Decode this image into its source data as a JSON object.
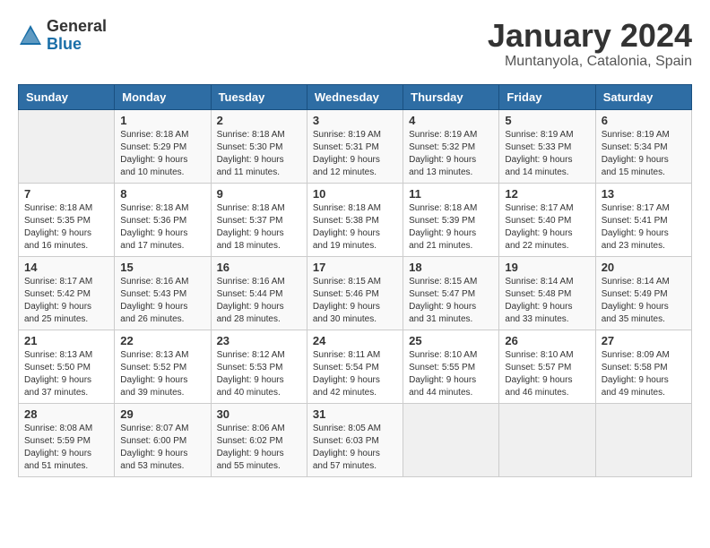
{
  "header": {
    "logo_general": "General",
    "logo_blue": "Blue",
    "title": "January 2024",
    "subtitle": "Muntanyola, Catalonia, Spain"
  },
  "days_of_week": [
    "Sunday",
    "Monday",
    "Tuesday",
    "Wednesday",
    "Thursday",
    "Friday",
    "Saturday"
  ],
  "weeks": [
    [
      {
        "day": "",
        "sunrise": "",
        "sunset": "",
        "daylight": ""
      },
      {
        "day": "1",
        "sunrise": "Sunrise: 8:18 AM",
        "sunset": "Sunset: 5:29 PM",
        "daylight": "Daylight: 9 hours and 10 minutes."
      },
      {
        "day": "2",
        "sunrise": "Sunrise: 8:18 AM",
        "sunset": "Sunset: 5:30 PM",
        "daylight": "Daylight: 9 hours and 11 minutes."
      },
      {
        "day": "3",
        "sunrise": "Sunrise: 8:19 AM",
        "sunset": "Sunset: 5:31 PM",
        "daylight": "Daylight: 9 hours and 12 minutes."
      },
      {
        "day": "4",
        "sunrise": "Sunrise: 8:19 AM",
        "sunset": "Sunset: 5:32 PM",
        "daylight": "Daylight: 9 hours and 13 minutes."
      },
      {
        "day": "5",
        "sunrise": "Sunrise: 8:19 AM",
        "sunset": "Sunset: 5:33 PM",
        "daylight": "Daylight: 9 hours and 14 minutes."
      },
      {
        "day": "6",
        "sunrise": "Sunrise: 8:19 AM",
        "sunset": "Sunset: 5:34 PM",
        "daylight": "Daylight: 9 hours and 15 minutes."
      }
    ],
    [
      {
        "day": "7",
        "sunrise": "Sunrise: 8:18 AM",
        "sunset": "Sunset: 5:35 PM",
        "daylight": "Daylight: 9 hours and 16 minutes."
      },
      {
        "day": "8",
        "sunrise": "Sunrise: 8:18 AM",
        "sunset": "Sunset: 5:36 PM",
        "daylight": "Daylight: 9 hours and 17 minutes."
      },
      {
        "day": "9",
        "sunrise": "Sunrise: 8:18 AM",
        "sunset": "Sunset: 5:37 PM",
        "daylight": "Daylight: 9 hours and 18 minutes."
      },
      {
        "day": "10",
        "sunrise": "Sunrise: 8:18 AM",
        "sunset": "Sunset: 5:38 PM",
        "daylight": "Daylight: 9 hours and 19 minutes."
      },
      {
        "day": "11",
        "sunrise": "Sunrise: 8:18 AM",
        "sunset": "Sunset: 5:39 PM",
        "daylight": "Daylight: 9 hours and 21 minutes."
      },
      {
        "day": "12",
        "sunrise": "Sunrise: 8:17 AM",
        "sunset": "Sunset: 5:40 PM",
        "daylight": "Daylight: 9 hours and 22 minutes."
      },
      {
        "day": "13",
        "sunrise": "Sunrise: 8:17 AM",
        "sunset": "Sunset: 5:41 PM",
        "daylight": "Daylight: 9 hours and 23 minutes."
      }
    ],
    [
      {
        "day": "14",
        "sunrise": "Sunrise: 8:17 AM",
        "sunset": "Sunset: 5:42 PM",
        "daylight": "Daylight: 9 hours and 25 minutes."
      },
      {
        "day": "15",
        "sunrise": "Sunrise: 8:16 AM",
        "sunset": "Sunset: 5:43 PM",
        "daylight": "Daylight: 9 hours and 26 minutes."
      },
      {
        "day": "16",
        "sunrise": "Sunrise: 8:16 AM",
        "sunset": "Sunset: 5:44 PM",
        "daylight": "Daylight: 9 hours and 28 minutes."
      },
      {
        "day": "17",
        "sunrise": "Sunrise: 8:15 AM",
        "sunset": "Sunset: 5:46 PM",
        "daylight": "Daylight: 9 hours and 30 minutes."
      },
      {
        "day": "18",
        "sunrise": "Sunrise: 8:15 AM",
        "sunset": "Sunset: 5:47 PM",
        "daylight": "Daylight: 9 hours and 31 minutes."
      },
      {
        "day": "19",
        "sunrise": "Sunrise: 8:14 AM",
        "sunset": "Sunset: 5:48 PM",
        "daylight": "Daylight: 9 hours and 33 minutes."
      },
      {
        "day": "20",
        "sunrise": "Sunrise: 8:14 AM",
        "sunset": "Sunset: 5:49 PM",
        "daylight": "Daylight: 9 hours and 35 minutes."
      }
    ],
    [
      {
        "day": "21",
        "sunrise": "Sunrise: 8:13 AM",
        "sunset": "Sunset: 5:50 PM",
        "daylight": "Daylight: 9 hours and 37 minutes."
      },
      {
        "day": "22",
        "sunrise": "Sunrise: 8:13 AM",
        "sunset": "Sunset: 5:52 PM",
        "daylight": "Daylight: 9 hours and 39 minutes."
      },
      {
        "day": "23",
        "sunrise": "Sunrise: 8:12 AM",
        "sunset": "Sunset: 5:53 PM",
        "daylight": "Daylight: 9 hours and 40 minutes."
      },
      {
        "day": "24",
        "sunrise": "Sunrise: 8:11 AM",
        "sunset": "Sunset: 5:54 PM",
        "daylight": "Daylight: 9 hours and 42 minutes."
      },
      {
        "day": "25",
        "sunrise": "Sunrise: 8:10 AM",
        "sunset": "Sunset: 5:55 PM",
        "daylight": "Daylight: 9 hours and 44 minutes."
      },
      {
        "day": "26",
        "sunrise": "Sunrise: 8:10 AM",
        "sunset": "Sunset: 5:57 PM",
        "daylight": "Daylight: 9 hours and 46 minutes."
      },
      {
        "day": "27",
        "sunrise": "Sunrise: 8:09 AM",
        "sunset": "Sunset: 5:58 PM",
        "daylight": "Daylight: 9 hours and 49 minutes."
      }
    ],
    [
      {
        "day": "28",
        "sunrise": "Sunrise: 8:08 AM",
        "sunset": "Sunset: 5:59 PM",
        "daylight": "Daylight: 9 hours and 51 minutes."
      },
      {
        "day": "29",
        "sunrise": "Sunrise: 8:07 AM",
        "sunset": "Sunset: 6:00 PM",
        "daylight": "Daylight: 9 hours and 53 minutes."
      },
      {
        "day": "30",
        "sunrise": "Sunrise: 8:06 AM",
        "sunset": "Sunset: 6:02 PM",
        "daylight": "Daylight: 9 hours and 55 minutes."
      },
      {
        "day": "31",
        "sunrise": "Sunrise: 8:05 AM",
        "sunset": "Sunset: 6:03 PM",
        "daylight": "Daylight: 9 hours and 57 minutes."
      },
      {
        "day": "",
        "sunrise": "",
        "sunset": "",
        "daylight": ""
      },
      {
        "day": "",
        "sunrise": "",
        "sunset": "",
        "daylight": ""
      },
      {
        "day": "",
        "sunrise": "",
        "sunset": "",
        "daylight": ""
      }
    ]
  ]
}
